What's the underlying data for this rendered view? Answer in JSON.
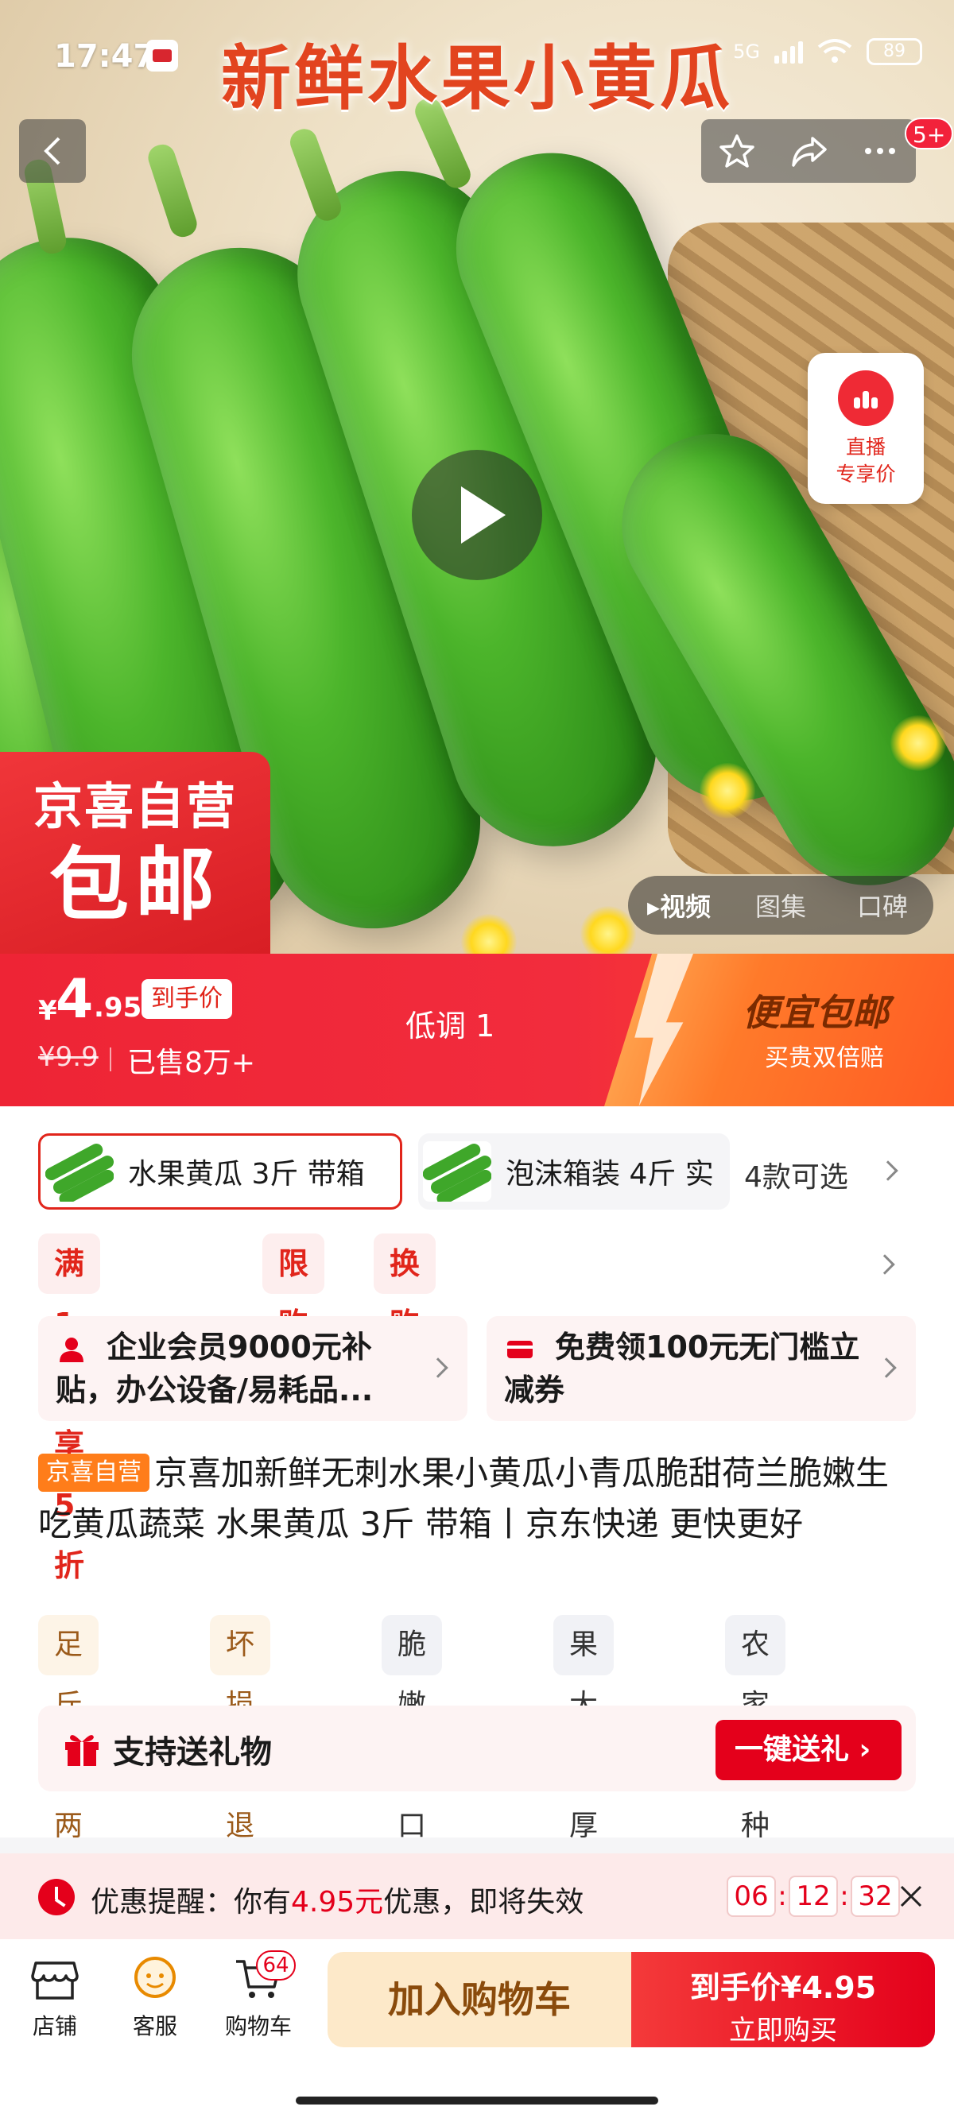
{
  "status_bar": {
    "time": "17:47",
    "network": "5G",
    "battery": "89"
  },
  "hero": {
    "title": "新鲜水果小黄瓜",
    "cart_badge": "5+",
    "live": {
      "line1": "直播",
      "line2": "专享价"
    },
    "promo": {
      "line1": "京喜自营",
      "line2": "包邮"
    },
    "media_tabs": [
      "视频",
      "图集",
      "口碑"
    ]
  },
  "price_bar": {
    "currency": "¥",
    "price_int": "4",
    "price_dec": ".95",
    "tag": "到手价",
    "original": "¥9.9",
    "sold": "已售8万+",
    "subtitle": "低调 1",
    "cheap_title": "便宜包邮",
    "cheap_sub": "买贵双倍赔"
  },
  "sku": {
    "options": [
      "水果黄瓜 3斤 带箱",
      "泡沫箱装 4斤 实"
    ],
    "more": "4款可选"
  },
  "promo_tags": [
    "满1已享5折",
    "限购",
    "换购"
  ],
  "coupons": [
    {
      "text": "企业会员9000元补贴，办公设备/易耗品..."
    },
    {
      "text": "免费领100元无门槛立减券"
    }
  ],
  "title": {
    "badge": "京喜自营",
    "text": "京喜加新鲜无刺水果小黄瓜小青瓜脆甜荷兰脆嫩生吃黄瓜蔬菜 水果黄瓜 3斤 带箱丨京东快递 更快更好"
  },
  "features": [
    "足斤足两",
    "坏损包退",
    "脆嫩爽口",
    "果大肉厚",
    "农家自种"
  ],
  "gift": {
    "label": "支持送礼物",
    "button": "一键送礼"
  },
  "reminder": {
    "prefix": "优惠提醒：你有",
    "amount": "4.95元",
    "suffix": "优惠，即将失效",
    "hours": "06",
    "minutes": "12",
    "seconds": "32"
  },
  "bottom_bar": {
    "shop": "店铺",
    "service": "客服",
    "cart": "购物车",
    "cart_count": "64",
    "add_to_cart": "加入购物车",
    "buy_line1": "到手价¥4.95",
    "buy_line2": "立即购买"
  },
  "colors": {
    "brand_red": "#e4001b",
    "promo_orange": "#ff7d1a",
    "cucumber_green": "#3fa72a"
  }
}
